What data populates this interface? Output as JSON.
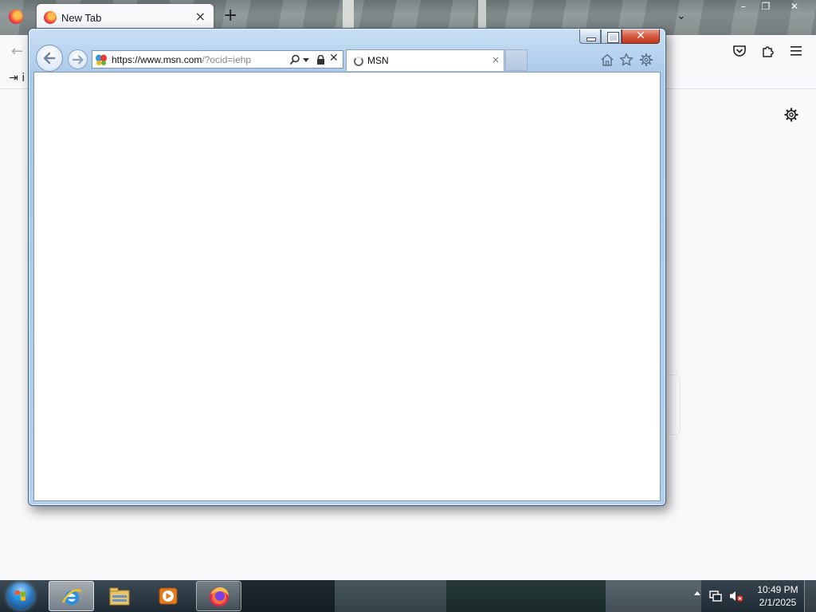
{
  "firefox": {
    "tab": {
      "title": "New Tab"
    },
    "bookmarks": {
      "signin_text": "i"
    }
  },
  "ie": {
    "address": {
      "scheme": "https://www.",
      "host": "msn.com",
      "path": "/?ocid=iehp"
    },
    "tab": {
      "title": "MSN",
      "close": "×"
    },
    "colors": {
      "frame": "#b3d0ee",
      "close_button": "#c03a1e"
    }
  },
  "taskbar": {
    "clock": {
      "time": "10:49 PM",
      "date": "2/1/2025"
    },
    "pinned": [
      "internet-explorer-icon",
      "windows-explorer-icon",
      "media-player-icon",
      "firefox-icon"
    ]
  }
}
